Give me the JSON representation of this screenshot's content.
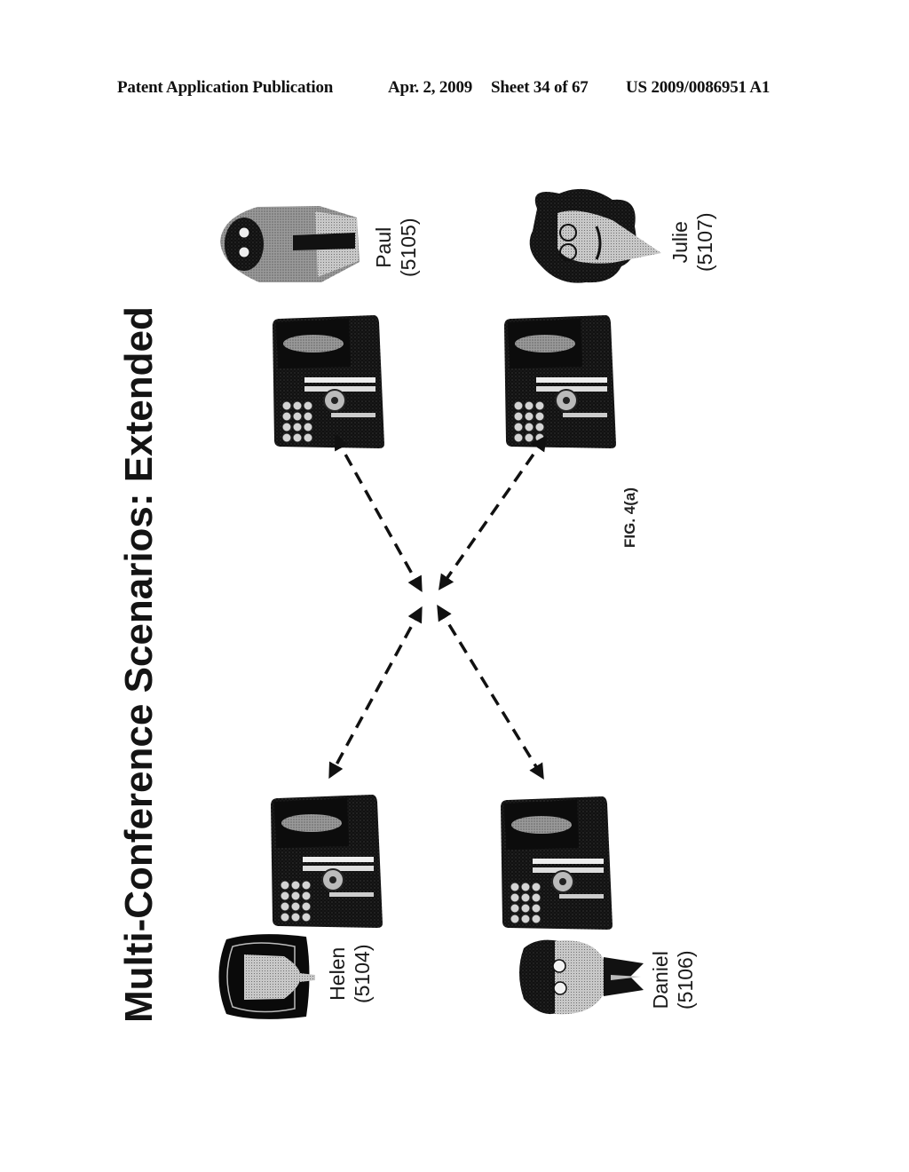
{
  "header": {
    "publication": "Patent Application Publication",
    "date": "Apr. 2, 2009",
    "sheet": "Sheet 34 of 67",
    "patent_number": "US 2009/0086951 A1"
  },
  "figure": {
    "title": "Multi-Conference Scenarios: Extended",
    "label": "FIG. 4(a)",
    "participants": [
      {
        "name": "Paul",
        "id": "(5105)",
        "icon": "man-with-tie-avatar"
      },
      {
        "name": "Julie",
        "id": "(5107)",
        "icon": "woman-curly-hair-avatar"
      },
      {
        "name": "Helen",
        "id": "(5104)",
        "icon": "woman-dark-hair-avatar"
      },
      {
        "name": "Daniel",
        "id": "(5106)",
        "icon": "man-curly-hair-avatar"
      }
    ],
    "devices": [
      "desk-phone",
      "desk-phone",
      "desk-phone",
      "desk-phone"
    ],
    "connections": "Four bidirectional dashed arrows joining each phone to a central conference point"
  }
}
